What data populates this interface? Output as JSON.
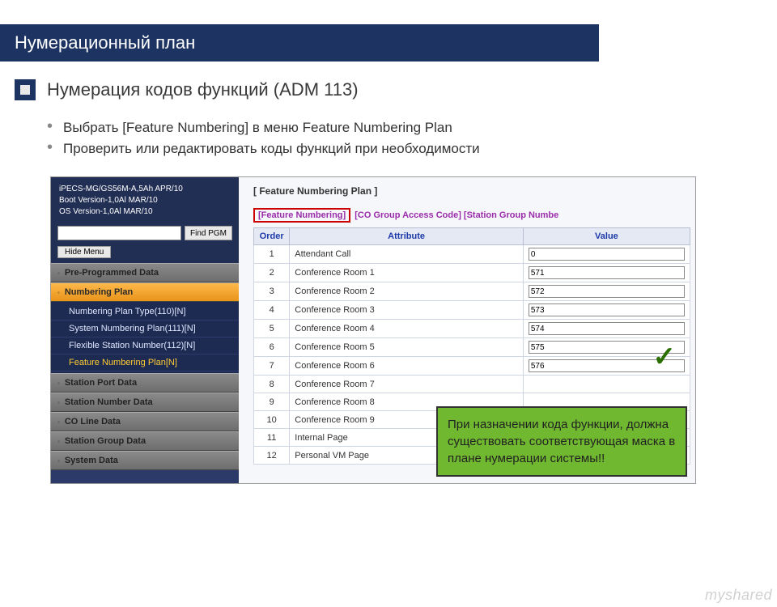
{
  "page": {
    "title": "Нумерационный план",
    "subtitle": "Нумерация кодов функций (ADM 113)",
    "bullets": [
      "Выбрать [Feature Numbering] в меню Feature Numbering Plan",
      "Проверить или редактировать коды функций при необходимости"
    ]
  },
  "sidebar": {
    "info_lines": [
      "iPECS-MG/GS56M-A,5Ah APR/10",
      "Boot Version-1,0Al MAR/10",
      "OS Version-1,0Al MAR/10"
    ],
    "find_pgm_label": "Find PGM",
    "hide_menu_label": "Hide Menu",
    "sections": [
      {
        "label": "Pre-Programmed Data",
        "active": false
      },
      {
        "label": "Numbering Plan",
        "active": true
      },
      {
        "label": "Station Port Data",
        "active": false
      },
      {
        "label": "Station Number Data",
        "active": false
      },
      {
        "label": "CO Line Data",
        "active": false
      },
      {
        "label": "Station Group Data",
        "active": false
      },
      {
        "label": "System Data",
        "active": false
      }
    ],
    "submenu": [
      {
        "label": "Numbering Plan Type(110)[N]",
        "active": false
      },
      {
        "label": "System Numbering Plan(111)[N]",
        "active": false
      },
      {
        "label": "Flexible Station Number(112)[N]",
        "active": false
      },
      {
        "label": "Feature Numbering Plan[N]",
        "active": true
      }
    ]
  },
  "content": {
    "panel_title": "[  Feature Numbering Plan  ]",
    "tabs": {
      "highlighted": "[Feature Numbering]",
      "rest": "[CO Group Access Code] [Station Group Numbe"
    },
    "headers": {
      "order": "Order",
      "attribute": "Attribute",
      "value": "Value"
    },
    "rows": [
      {
        "order": "1",
        "attr": "Attendant Call",
        "val": "0"
      },
      {
        "order": "2",
        "attr": "Conference Room 1",
        "val": "571"
      },
      {
        "order": "3",
        "attr": "Conference Room 2",
        "val": "572"
      },
      {
        "order": "4",
        "attr": "Conference Room 3",
        "val": "573"
      },
      {
        "order": "5",
        "attr": "Conference Room 4",
        "val": "574"
      },
      {
        "order": "6",
        "attr": "Conference Room 5",
        "val": "575"
      },
      {
        "order": "7",
        "attr": "Conference Room 6",
        "val": "576"
      },
      {
        "order": "8",
        "attr": "Conference Room 7",
        "val": ""
      },
      {
        "order": "9",
        "attr": "Conference Room 8",
        "val": ""
      },
      {
        "order": "10",
        "attr": "Conference Room 9",
        "val": ""
      },
      {
        "order": "11",
        "attr": "Internal Page",
        "val": ""
      },
      {
        "order": "12",
        "attr": "Personal VM Page",
        "val": ""
      }
    ]
  },
  "callout": {
    "text": "При назначении кода функции, должна существовать соответствующая маска в плане нумерации системы!!"
  },
  "watermark": "myshared"
}
